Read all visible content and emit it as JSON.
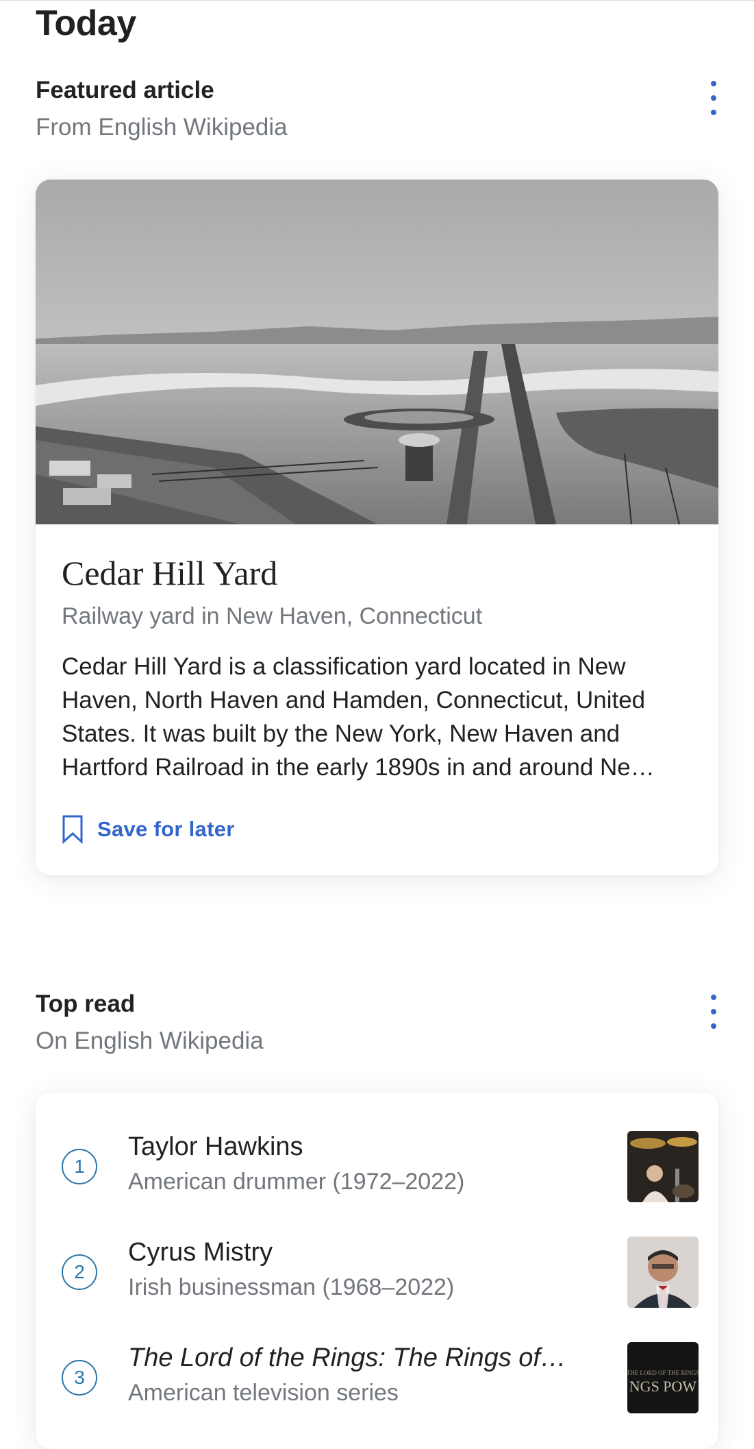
{
  "page": {
    "title": "Today"
  },
  "featured": {
    "section_title": "Featured article",
    "section_subtitle": "From English Wikipedia",
    "article_title": "Cedar Hill Yard",
    "article_description": "Railway yard in New Haven, Connecticut",
    "extract": "Cedar Hill Yard is a classification yard located in New Haven, North Haven and Hamden, Connecticut, United States. It was built by the New York, New Haven and Hartford Railroad in the early 1890s in and around Ne…",
    "save_label": "Save for later"
  },
  "top_read": {
    "section_title": "Top read",
    "section_subtitle": "On English Wikipedia",
    "items": [
      {
        "rank": "1",
        "title": "Taylor Hawkins",
        "description": "American drummer (1972–2022)"
      },
      {
        "rank": "2",
        "title": "Cyrus Mistry",
        "description": "Irish businessman (1968–2022)"
      },
      {
        "rank": "3",
        "title": "The Lord of the Rings: The Rings of…",
        "description": "American television series"
      }
    ]
  },
  "colors": {
    "accent": "#3366cc",
    "rank_circle": "#2a75a8",
    "secondary_text": "#72777d",
    "primary_text": "#202122"
  }
}
